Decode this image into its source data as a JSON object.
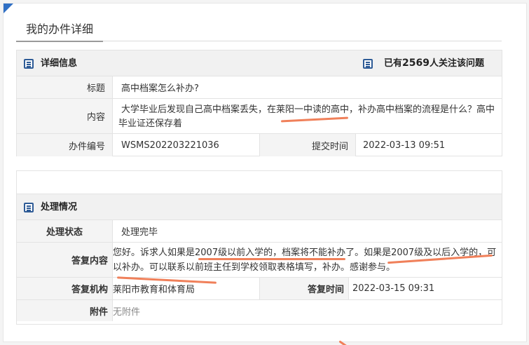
{
  "page": {
    "title": "我的办件详细"
  },
  "detail": {
    "heading": "详细信息",
    "followers_prefix": "已有",
    "followers_count": "2569",
    "followers_suffix": "人关注该问题",
    "title_label": "标题",
    "title_value": "高中档案怎么补办?",
    "content_label": "内容",
    "content_line1": "大学毕业后发现自己高中档案丢失，在莱阳一中读的高中，补办高中档案的流程是什么？高中",
    "content_line2": "毕业证还保存着",
    "case_no_label": "办件编号",
    "case_no_value": "WSMS202203221036",
    "submit_time_label": "提交时间",
    "submit_time_value": "2022-03-13 09:51"
  },
  "handling": {
    "heading": "处理情况",
    "status_label": "处理状态",
    "status_value": "处理完毕",
    "reply_label": "答复内容",
    "reply_line1": "您好。诉求人如果是2007级以前入学的，档案将不能补办了。如果是2007级及以后入学的，可",
    "reply_line2": "以补办。可以联系以前班主任到学校领取表格填写，补办。感谢参与。",
    "org_label": "答复机构",
    "org_value": "莱阳市教育和体育局",
    "reply_time_label": "答复时间",
    "reply_time_value": "2022-03-15 09:31",
    "attachment_label": "附件",
    "attachment_value": "无附件"
  },
  "colors": {
    "accent": "#2f6fc4",
    "icon": "#2e5b96",
    "highlight": "#f0805a"
  }
}
